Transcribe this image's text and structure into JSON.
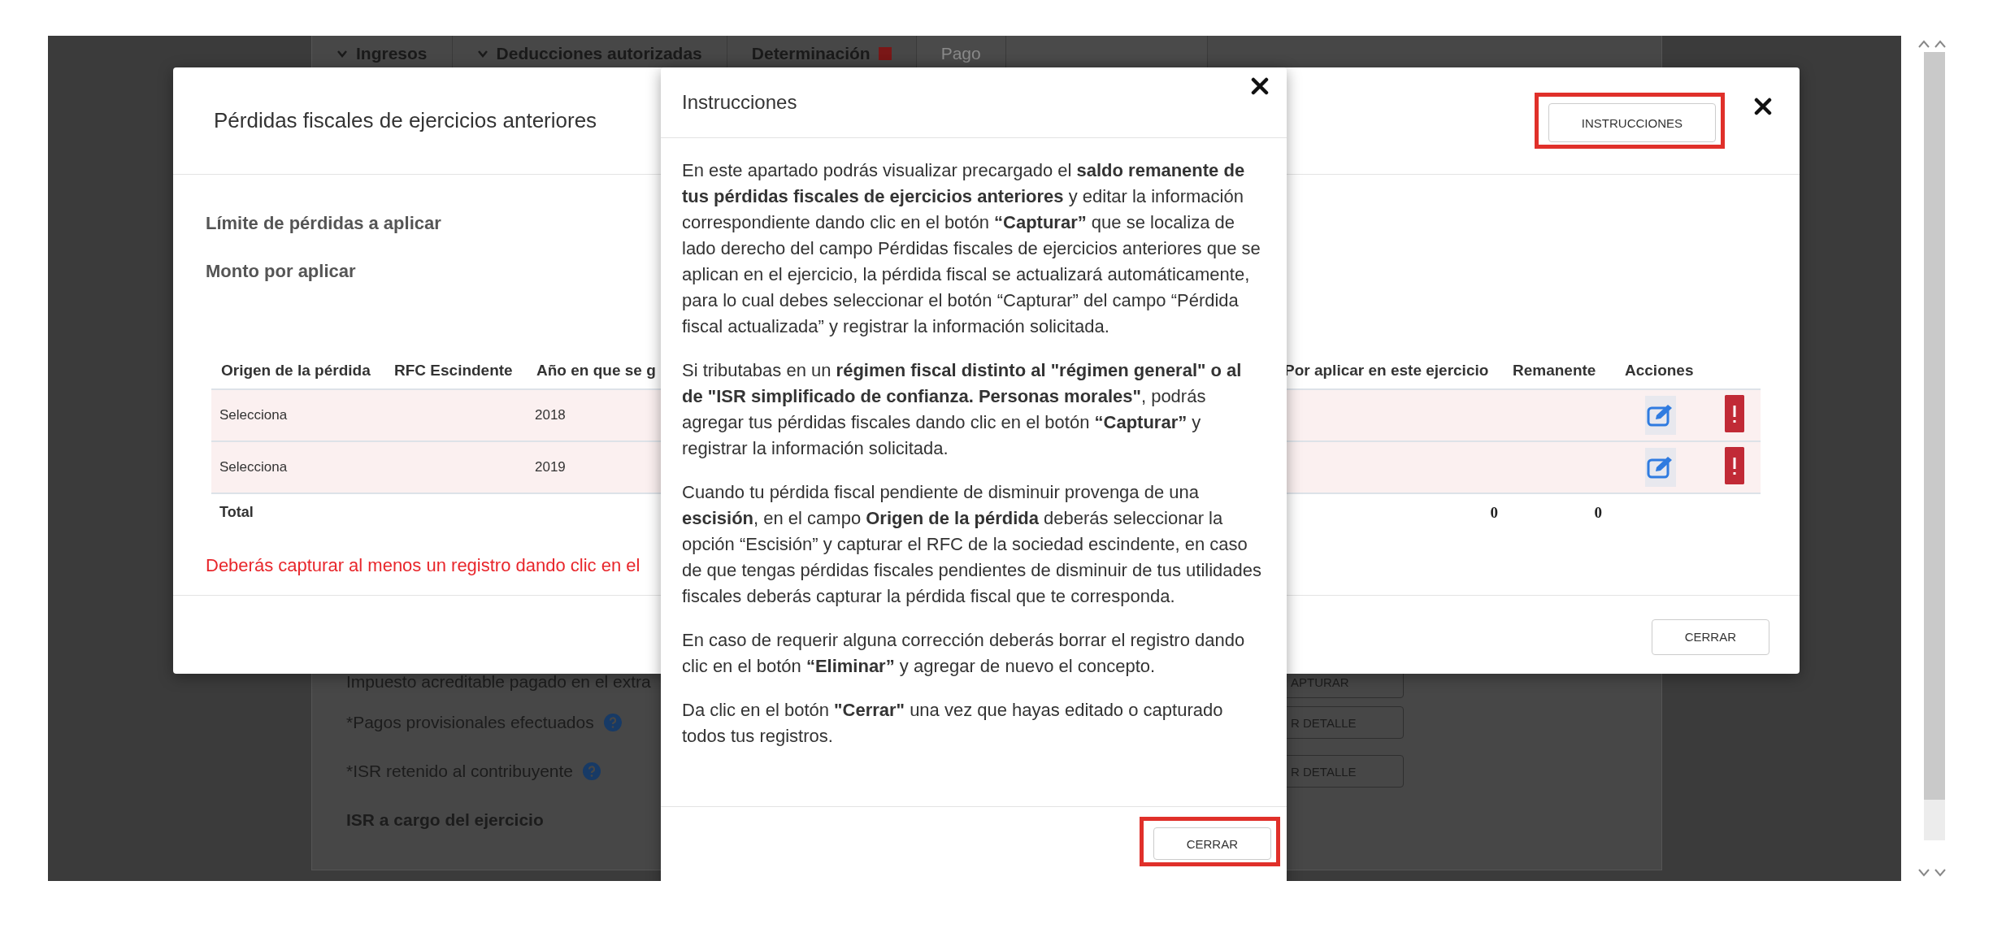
{
  "background_page": {
    "tabs": [
      {
        "label": "Ingresos",
        "caret": true,
        "badge": false,
        "disabled": false
      },
      {
        "label": "Deducciones autorizadas",
        "caret": true,
        "badge": false,
        "disabled": false
      },
      {
        "label": "Determinación",
        "caret": false,
        "badge": true,
        "disabled": false
      },
      {
        "label": "Pago",
        "caret": false,
        "badge": false,
        "disabled": true
      }
    ],
    "rows": [
      {
        "label": "Impuesto acreditable pagado en el extra",
        "button": "APTURAR"
      },
      {
        "label": "*Pagos provisionales efectuados",
        "help": true,
        "button": "R DETALLE"
      },
      {
        "label": "*ISR retenido al contribuyente",
        "help": true,
        "button": "R DETALLE"
      }
    ],
    "total_label": "ISR a cargo del ejercicio"
  },
  "dialog": {
    "title": "Pérdidas fiscales de ejercicios anteriores",
    "instructions_button": {
      "label": "INSTRUCCIONES",
      "highlighted": true
    },
    "fields": [
      "Límite de pérdidas a aplicar",
      "Monto por aplicar"
    ],
    "table": {
      "columns": [
        "Origen de la pérdida",
        "RFC Escindente",
        "Año en que se g",
        "Por aplicar en este ejercicio",
        "Remanente",
        "Acciones"
      ],
      "rows": [
        {
          "origin": "Selecciona",
          "year": "2018",
          "error": true
        },
        {
          "origin": "Selecciona",
          "year": "2019",
          "error": true
        }
      ],
      "total": {
        "label": "Total",
        "por_aplicar": "0",
        "remanente": "0"
      }
    },
    "warning": "Deberás capturar al menos un registro dando clic en el",
    "close_button": {
      "label": "CERRAR",
      "highlighted": false
    }
  },
  "instructions": {
    "title": "Instrucciones",
    "paragraphs": [
      "En este apartado podrás visualizar precargado el **saldo remanente de tus pérdidas fiscales de ejercicios anteriores** y editar la información correspondiente dando clic en el botón **“Capturar”** que se localiza de lado derecho del campo Pérdidas fiscales de ejercicios anteriores que se aplican en el ejercicio, la pérdida fiscal se actualizará automáticamente, para lo cual debes seleccionar el botón “Capturar” del campo “Pérdida fiscal actualizada” y registrar la información solicitada.",
      "Si tributabas en un **régimen fiscal distinto al \"régimen general\" o al de \"ISR simplificado de confianza. Personas morales\"**, podrás agregar tus pérdidas fiscales dando clic en el botón **“Capturar”** y registrar la información solicitada.",
      "Cuando tu pérdida fiscal pendiente de disminuir provenga de una **escisión**, en el campo **Origen de la pérdida** deberás seleccionar la opción “Escisión” y capturar el RFC de la sociedad escindente, en caso de que tengas pérdidas fiscales pendientes de disminuir de tus utilidades fiscales deberás capturar la pérdida fiscal que te corresponda.",
      "En caso de requerir alguna corrección deberás borrar el registro dando clic en el botón **“Eliminar”** y agregar de nuevo el concepto.",
      "Da clic en el botón **\"Cerrar\"** una vez que hayas editado o capturado todos tus registros."
    ],
    "close_button": {
      "label": "CERRAR",
      "highlighted": true
    }
  }
}
